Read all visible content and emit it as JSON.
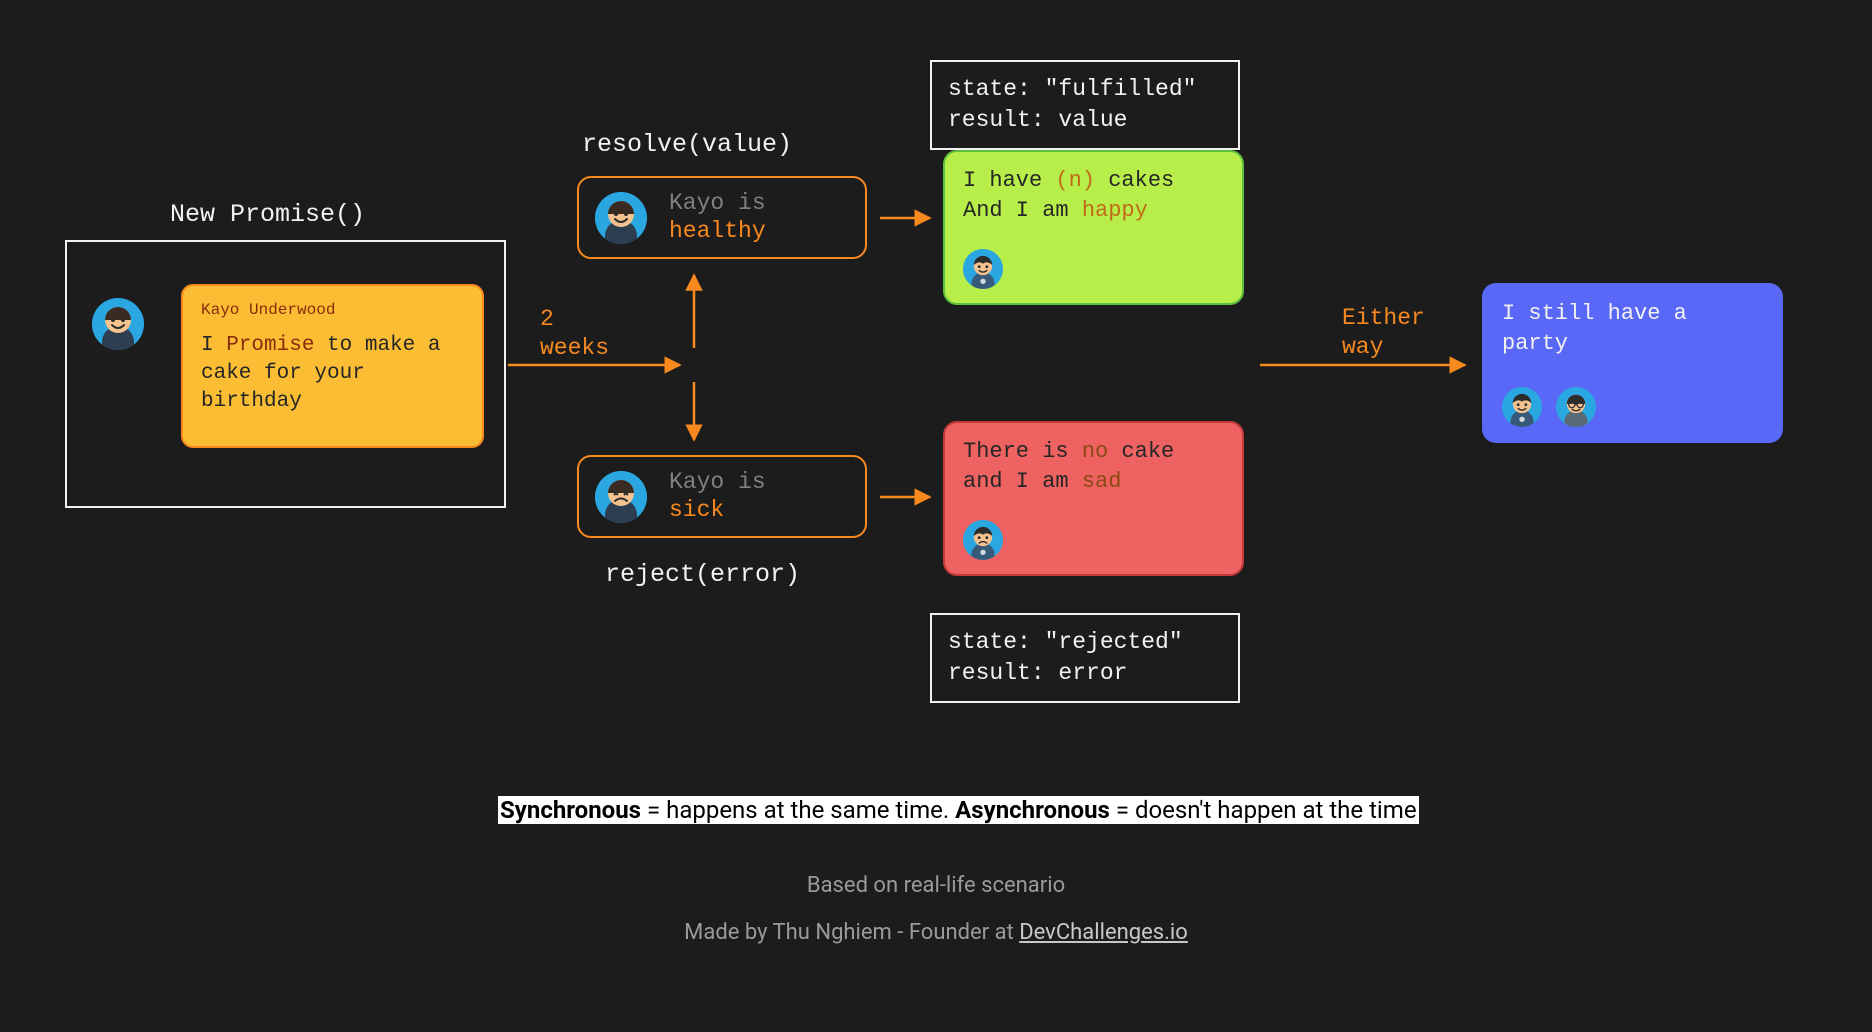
{
  "promise": {
    "title": "New Promise()",
    "card": {
      "name": "Kayo Underwood",
      "pre": "I ",
      "hl": "Promise",
      "post": " to make a cake for your birthday"
    }
  },
  "labels": {
    "two_weeks_l1": "2",
    "two_weeks_l2": "weeks",
    "resolve": "resolve(value)",
    "reject": "reject(error)",
    "either_l1": "Either",
    "either_l2": "way"
  },
  "states": {
    "healthy_pre": "Kayo is",
    "healthy_hl": "healthy",
    "sick_pre": "Kayo is",
    "sick_hl": "sick"
  },
  "info": {
    "fulfilled_l1": "state: \"fulfilled\"",
    "fulfilled_l2": "result: value",
    "rejected_l1": "state: \"rejected\"",
    "rejected_l2": "result: error"
  },
  "happy": {
    "l1_pre": "I have ",
    "l1_hl": "(n)",
    "l1_post": " cakes",
    "l2_pre": "And I am ",
    "l2_hl": "happy"
  },
  "sad": {
    "l1_pre": "There is ",
    "l1_hl": "no",
    "l1_post": " cake",
    "l2_pre": "and I am ",
    "l2_hl": "sad"
  },
  "party": {
    "text": "I still have a party"
  },
  "footer": {
    "definition_sync_b": "Synchronous",
    "definition_sync_t": " = happens at the same time. ",
    "definition_async_b": "Asynchronous",
    "definition_async_t": " = doesn't happen at the time",
    "based": "Based on real-life scenario",
    "made_pre": "Made by Thu Nghiem - Founder at ",
    "made_link": "DevChallenges.io"
  }
}
